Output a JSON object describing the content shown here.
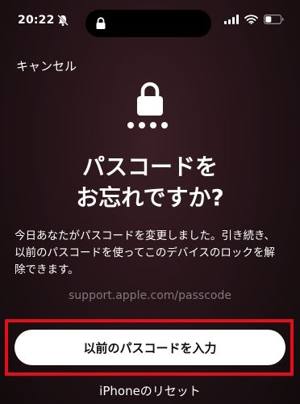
{
  "status": {
    "time": "20:22",
    "icons": [
      "bell-slash-icon",
      "lock-icon",
      "cellular-signal-icon",
      "wifi-icon",
      "battery-icon"
    ]
  },
  "nav": {
    "cancel_label": "キャンセル"
  },
  "header": {
    "icons": [
      "lock-icon",
      "passcode-dots-icon"
    ],
    "title_line1": "パスコードを",
    "title_line2": "お忘れですか?"
  },
  "body": {
    "description": "今日あなたがパスコードを変更しました。引き続き、以前のパスコードを使ってこのデバイスのロックを解除できます。",
    "link": "support.apple.com/passcode"
  },
  "actions": {
    "primary_label": "以前のパスコードを入力",
    "secondary_label": "iPhoneのリセット"
  },
  "colors": {
    "highlight": "#e0101a",
    "background": "#261419",
    "link_text": "#7e7a7b"
  }
}
